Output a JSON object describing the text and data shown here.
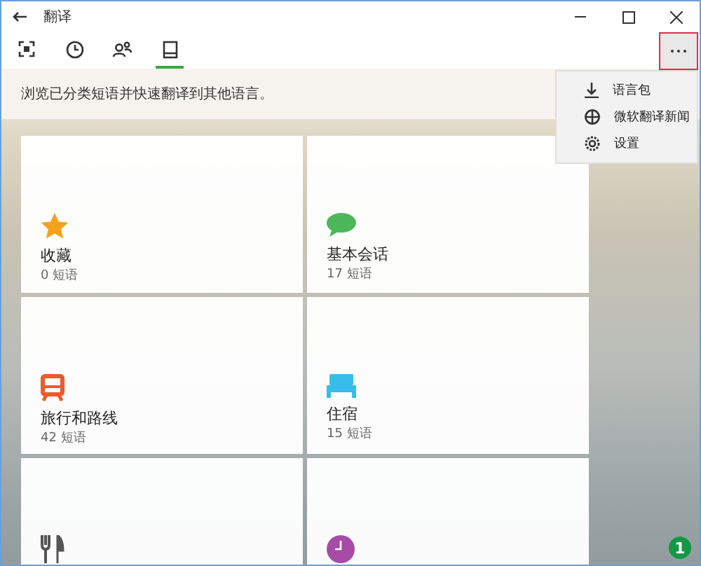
{
  "window": {
    "title": "翻译"
  },
  "tabs": [
    {
      "kind": "camera",
      "selected": false
    },
    {
      "kind": "history",
      "selected": false
    },
    {
      "kind": "people",
      "selected": false
    },
    {
      "kind": "phrasebook",
      "selected": true
    }
  ],
  "description": "浏览已分类短语并快速翻译到其他语言。",
  "categories": [
    {
      "kind": "star",
      "color": "#f7a21b",
      "title": "收藏",
      "count": "0 短语"
    },
    {
      "kind": "chat",
      "color": "#4cb85a",
      "title": "基本会话",
      "count": "17 短语"
    },
    {
      "kind": "train",
      "color": "#f0592a",
      "title": "旅行和路线",
      "count": "42 短语"
    },
    {
      "kind": "bed",
      "color": "#37bdea",
      "title": "住宿",
      "count": "15 短语"
    },
    {
      "kind": "cutlery",
      "color": "#555555"
    },
    {
      "kind": "clock",
      "color": "#a64ca6"
    }
  ],
  "menu": [
    {
      "kind": "download",
      "label": "语言包"
    },
    {
      "kind": "globe",
      "label": "微软翻译新闻"
    },
    {
      "kind": "gear",
      "label": "设置"
    }
  ],
  "badge": "1"
}
